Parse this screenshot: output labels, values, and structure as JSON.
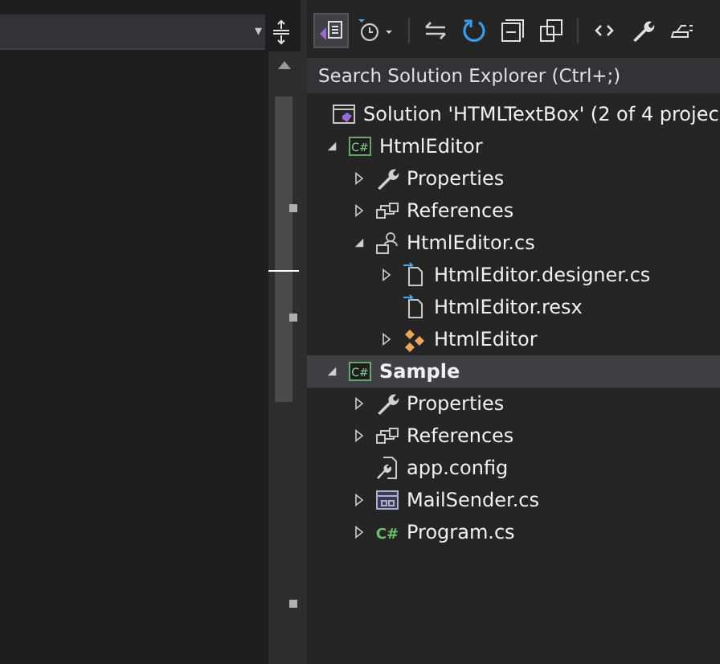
{
  "editor": {
    "dropdown": {
      "caret": "▾"
    }
  },
  "solution_explorer": {
    "toolbar": [
      {
        "kind": "home",
        "selected": true
      },
      {
        "kind": "history",
        "selected": false
      },
      {
        "kind": "sync",
        "selected": false
      },
      {
        "kind": "refresh",
        "selected": false
      },
      {
        "kind": "collapse",
        "selected": false
      },
      {
        "kind": "copies",
        "selected": false
      },
      {
        "kind": "code",
        "selected": false
      },
      {
        "kind": "properties",
        "selected": false
      },
      {
        "kind": "preview",
        "selected": false
      }
    ],
    "search": {
      "placeholder": "Search Solution Explorer (Ctrl+;)"
    },
    "tree": [
      {
        "label": "Solution 'HTMLTextBox' (2 of 4 projec",
        "kind": "solution",
        "selected": false,
        "children": [
          {
            "label": "HtmlEditor",
            "kind": "csproject",
            "icon_text": "C#",
            "expanded": true,
            "selected": false,
            "startup": false,
            "children": [
              {
                "label": "Properties",
                "kind": "wrench",
                "expanded": false,
                "selected": false
              },
              {
                "label": "References",
                "kind": "references",
                "expanded": false,
                "selected": false
              },
              {
                "label": "HtmlEditor.cs",
                "kind": "usercontrol",
                "expanded": true,
                "selected": false,
                "children": [
                  {
                    "label": "HtmlEditor.designer.cs",
                    "kind": "designer",
                    "expanded": false,
                    "selected": false
                  },
                  {
                    "label": "HtmlEditor.resx",
                    "kind": "designer",
                    "selected": false
                  },
                  {
                    "label": "HtmlEditor",
                    "kind": "component",
                    "expanded": false,
                    "selected": false
                  }
                ]
              }
            ]
          },
          {
            "label": "Sample",
            "kind": "csproject",
            "icon_text": "C#",
            "expanded": true,
            "selected": true,
            "startup": true,
            "children": [
              {
                "label": "Properties",
                "kind": "wrench",
                "expanded": false,
                "selected": false
              },
              {
                "label": "References",
                "kind": "references",
                "expanded": false,
                "selected": false
              },
              {
                "label": "app.config",
                "kind": "config",
                "selected": false
              },
              {
                "label": "MailSender.cs",
                "kind": "form",
                "expanded": false,
                "selected": false
              },
              {
                "label": "Program.cs",
                "kind": "csfile",
                "icon_text": "C#",
                "expanded": false,
                "selected": false
              }
            ]
          }
        ]
      }
    ]
  }
}
